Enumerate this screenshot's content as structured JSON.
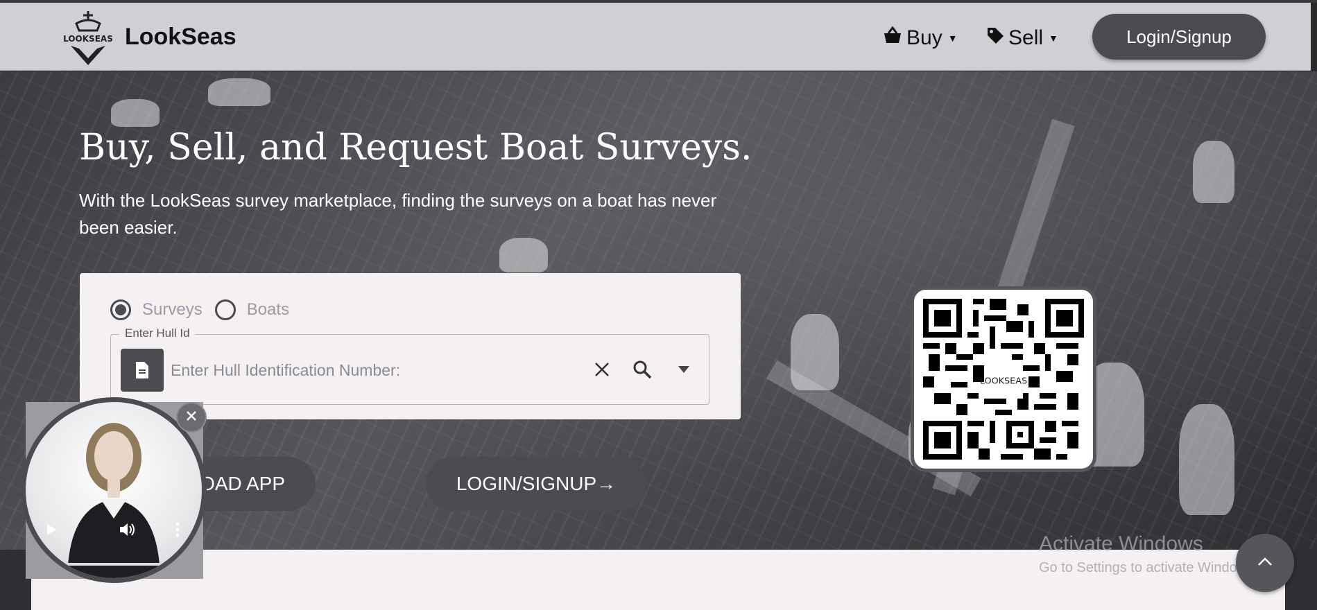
{
  "header": {
    "brand": "LookSeas",
    "logo_text": "LOOKSEAS",
    "nav_buy": "Buy",
    "nav_sell": "Sell",
    "login_label": "Login/Signup"
  },
  "hero": {
    "title": "Buy, Sell, and Request Boat Surveys.",
    "subtitle": "With the LookSeas survey marketplace, finding the surveys on a boat has never been easier."
  },
  "search": {
    "radio_surveys": "Surveys",
    "radio_boats": "Boats",
    "selected": "Surveys",
    "field_label": "Enter Hull Id",
    "placeholder": "Enter Hull Identification Number:",
    "value": ""
  },
  "actions": {
    "download_label": "OAD APP",
    "login_signup_label": "LOGIN/SIGNUP→"
  },
  "qr": {
    "center_text": "LOOKSEAS"
  },
  "watermark": {
    "line1": "Activate Windows",
    "line2": "Go to Settings to activate Windows."
  },
  "icons": {
    "buy": "basket-icon",
    "sell": "tag-icon",
    "file": "file-icon",
    "clear": "close-icon",
    "search": "search-icon",
    "dropdown": "caret-down-icon",
    "scroll_top": "chevron-up-icon",
    "video_close": "close-icon",
    "play": "play-icon",
    "volume": "volume-icon",
    "more": "more-vertical-icon"
  },
  "colors": {
    "header_bg": "#cfcfd6",
    "button_bg": "#4a4c52",
    "card_bg": "#f5f1f3"
  }
}
